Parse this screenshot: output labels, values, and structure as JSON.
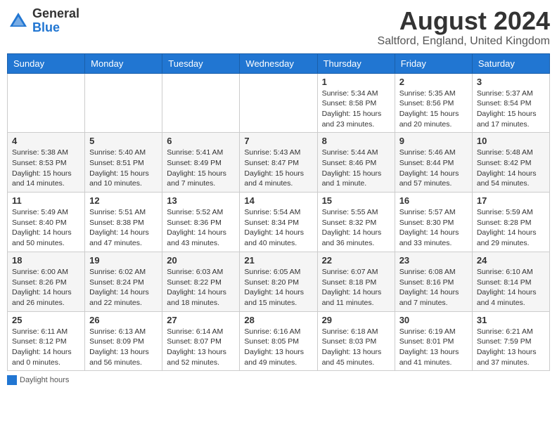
{
  "header": {
    "logo_general": "General",
    "logo_blue": "Blue",
    "month_year": "August 2024",
    "location": "Saltford, England, United Kingdom"
  },
  "days_of_week": [
    "Sunday",
    "Monday",
    "Tuesday",
    "Wednesday",
    "Thursday",
    "Friday",
    "Saturday"
  ],
  "weeks": [
    [
      {
        "day": "",
        "info": ""
      },
      {
        "day": "",
        "info": ""
      },
      {
        "day": "",
        "info": ""
      },
      {
        "day": "",
        "info": ""
      },
      {
        "day": "1",
        "info": "Sunrise: 5:34 AM\nSunset: 8:58 PM\nDaylight: 15 hours\nand 23 minutes."
      },
      {
        "day": "2",
        "info": "Sunrise: 5:35 AM\nSunset: 8:56 PM\nDaylight: 15 hours\nand 20 minutes."
      },
      {
        "day": "3",
        "info": "Sunrise: 5:37 AM\nSunset: 8:54 PM\nDaylight: 15 hours\nand 17 minutes."
      }
    ],
    [
      {
        "day": "4",
        "info": "Sunrise: 5:38 AM\nSunset: 8:53 PM\nDaylight: 15 hours\nand 14 minutes."
      },
      {
        "day": "5",
        "info": "Sunrise: 5:40 AM\nSunset: 8:51 PM\nDaylight: 15 hours\nand 10 minutes."
      },
      {
        "day": "6",
        "info": "Sunrise: 5:41 AM\nSunset: 8:49 PM\nDaylight: 15 hours\nand 7 minutes."
      },
      {
        "day": "7",
        "info": "Sunrise: 5:43 AM\nSunset: 8:47 PM\nDaylight: 15 hours\nand 4 minutes."
      },
      {
        "day": "8",
        "info": "Sunrise: 5:44 AM\nSunset: 8:46 PM\nDaylight: 15 hours\nand 1 minute."
      },
      {
        "day": "9",
        "info": "Sunrise: 5:46 AM\nSunset: 8:44 PM\nDaylight: 14 hours\nand 57 minutes."
      },
      {
        "day": "10",
        "info": "Sunrise: 5:48 AM\nSunset: 8:42 PM\nDaylight: 14 hours\nand 54 minutes."
      }
    ],
    [
      {
        "day": "11",
        "info": "Sunrise: 5:49 AM\nSunset: 8:40 PM\nDaylight: 14 hours\nand 50 minutes."
      },
      {
        "day": "12",
        "info": "Sunrise: 5:51 AM\nSunset: 8:38 PM\nDaylight: 14 hours\nand 47 minutes."
      },
      {
        "day": "13",
        "info": "Sunrise: 5:52 AM\nSunset: 8:36 PM\nDaylight: 14 hours\nand 43 minutes."
      },
      {
        "day": "14",
        "info": "Sunrise: 5:54 AM\nSunset: 8:34 PM\nDaylight: 14 hours\nand 40 minutes."
      },
      {
        "day": "15",
        "info": "Sunrise: 5:55 AM\nSunset: 8:32 PM\nDaylight: 14 hours\nand 36 minutes."
      },
      {
        "day": "16",
        "info": "Sunrise: 5:57 AM\nSunset: 8:30 PM\nDaylight: 14 hours\nand 33 minutes."
      },
      {
        "day": "17",
        "info": "Sunrise: 5:59 AM\nSunset: 8:28 PM\nDaylight: 14 hours\nand 29 minutes."
      }
    ],
    [
      {
        "day": "18",
        "info": "Sunrise: 6:00 AM\nSunset: 8:26 PM\nDaylight: 14 hours\nand 26 minutes."
      },
      {
        "day": "19",
        "info": "Sunrise: 6:02 AM\nSunset: 8:24 PM\nDaylight: 14 hours\nand 22 minutes."
      },
      {
        "day": "20",
        "info": "Sunrise: 6:03 AM\nSunset: 8:22 PM\nDaylight: 14 hours\nand 18 minutes."
      },
      {
        "day": "21",
        "info": "Sunrise: 6:05 AM\nSunset: 8:20 PM\nDaylight: 14 hours\nand 15 minutes."
      },
      {
        "day": "22",
        "info": "Sunrise: 6:07 AM\nSunset: 8:18 PM\nDaylight: 14 hours\nand 11 minutes."
      },
      {
        "day": "23",
        "info": "Sunrise: 6:08 AM\nSunset: 8:16 PM\nDaylight: 14 hours\nand 7 minutes."
      },
      {
        "day": "24",
        "info": "Sunrise: 6:10 AM\nSunset: 8:14 PM\nDaylight: 14 hours\nand 4 minutes."
      }
    ],
    [
      {
        "day": "25",
        "info": "Sunrise: 6:11 AM\nSunset: 8:12 PM\nDaylight: 14 hours\nand 0 minutes."
      },
      {
        "day": "26",
        "info": "Sunrise: 6:13 AM\nSunset: 8:09 PM\nDaylight: 13 hours\nand 56 minutes."
      },
      {
        "day": "27",
        "info": "Sunrise: 6:14 AM\nSunset: 8:07 PM\nDaylight: 13 hours\nand 52 minutes."
      },
      {
        "day": "28",
        "info": "Sunrise: 6:16 AM\nSunset: 8:05 PM\nDaylight: 13 hours\nand 49 minutes."
      },
      {
        "day": "29",
        "info": "Sunrise: 6:18 AM\nSunset: 8:03 PM\nDaylight: 13 hours\nand 45 minutes."
      },
      {
        "day": "30",
        "info": "Sunrise: 6:19 AM\nSunset: 8:01 PM\nDaylight: 13 hours\nand 41 minutes."
      },
      {
        "day": "31",
        "info": "Sunrise: 6:21 AM\nSunset: 7:59 PM\nDaylight: 13 hours\nand 37 minutes."
      }
    ]
  ],
  "footer": {
    "daylight_label": "Daylight hours"
  }
}
